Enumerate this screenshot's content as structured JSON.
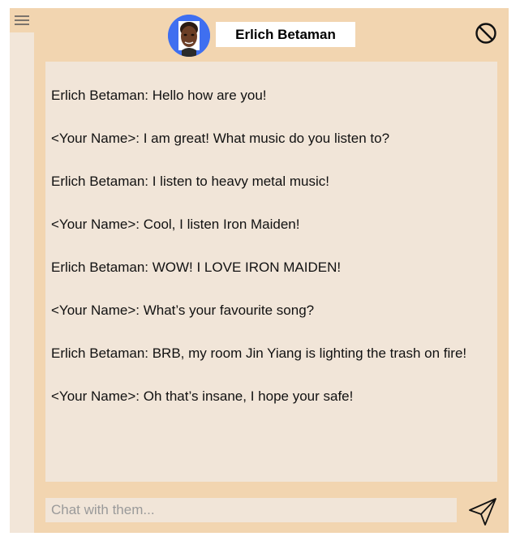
{
  "header": {
    "contact_name": "Erlich Betaman"
  },
  "icons": {
    "menu": "hamburger-menu-icon",
    "block": "block-icon",
    "send": "send-icon"
  },
  "messages": [
    {
      "text": "Erlich Betaman: Hello how are you!"
    },
    {
      "text": "<Your Name>: I am great! What music do you listen to?"
    },
    {
      "text": "Erlich Betaman: I listen to heavy metal music!"
    },
    {
      "text": "<Your Name>: Cool, I listen Iron Maiden!"
    },
    {
      "text": "Erlich Betaman: WOW! I LOVE IRON MAIDEN!"
    },
    {
      "text": "<Your Name>: What’s your favourite song?"
    },
    {
      "text": "Erlich Betaman: BRB, my room Jin Yiang is lighting the trash on fire!"
    },
    {
      "text": "<Your Name>: Oh that’s insane, I hope your safe!"
    }
  ],
  "composer": {
    "placeholder": "Chat with them...",
    "value": ""
  },
  "colors": {
    "panel": "#f2d5b0",
    "chat_background": "#f1e5d8",
    "avatar_ring": "#3f6ff0"
  }
}
